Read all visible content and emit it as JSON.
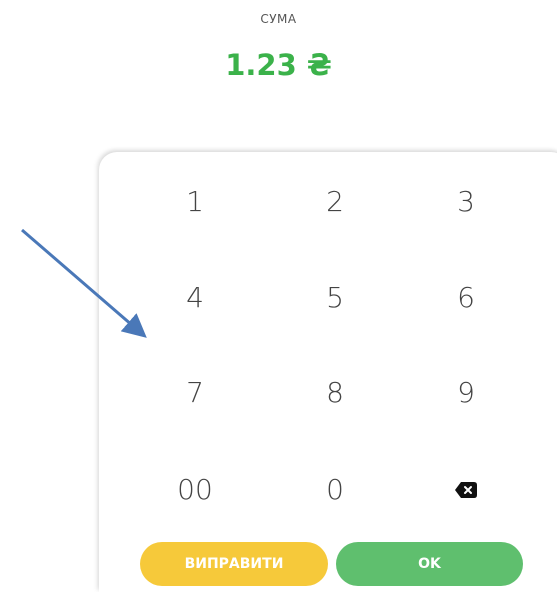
{
  "amount": {
    "label": "СУМА",
    "value": "1.23 ₴"
  },
  "keypad": {
    "keys": [
      "1",
      "2",
      "3",
      "4",
      "5",
      "6",
      "7",
      "8",
      "9",
      "00",
      "0"
    ],
    "backspace_icon": "backspace-icon"
  },
  "actions": {
    "fix_label": "ВИПРАВИТИ",
    "ok_label": "OK"
  },
  "colors": {
    "amount": "#3bb24a",
    "fix_button": "#f6c93a",
    "ok_button": "#5fbf6e",
    "arrow": "#4a78b8"
  }
}
